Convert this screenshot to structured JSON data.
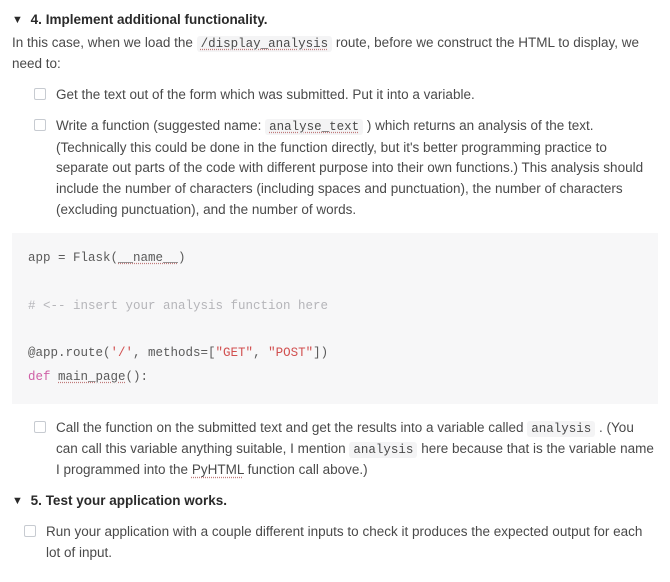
{
  "section4": {
    "num": "4.",
    "title": "Implement additional functionality.",
    "intro_a": "In this case, when we load the ",
    "route_code": "/display_analysis",
    "intro_b": " route, before we construct the HTML to display, we need to:",
    "item1": "Get the text out of the form which was submitted. Put it into a variable.",
    "item2_a": "Write a function (suggested name: ",
    "item2_code": "analyse_text",
    "item2_b": " ) which returns an analysis of the text. (Technically this could be done in the function directly, but it's better programming practice to separate out parts of the code with different purpose into their own functions.) This analysis should include the number of characters (including spaces and punctuation), the number of characters (excluding punctuation), and the number of words.",
    "item3_a": "Call the function on the submitted text and get the results into a variable called ",
    "item3_code1": "analysis",
    "item3_b": " . (You can call this variable anything suitable, I mention ",
    "item3_code2": "analysis",
    "item3_c": " here because that is the variable name I programmed into the ",
    "item3_pyhtml": "PyHTML",
    "item3_d": " function call above.)"
  },
  "code": {
    "l1a": "app = Flask(",
    "l1b": "__name__",
    "l1c": ")",
    "l2": "# <-- insert your analysis function here",
    "l3a": "@app.route(",
    "l3b": "'/'",
    "l3c": ", methods=[",
    "l3d": "\"GET\"",
    "l3e": ", ",
    "l3f": "\"POST\"",
    "l3g": "])",
    "l4a": "def",
    "l4b": " ",
    "l4c": "main_page",
    "l4d": "():"
  },
  "section5": {
    "num": "5.",
    "title": "Test your application works.",
    "item1": "Run your application with a couple different inputs to check it produces the expected output for each lot of input."
  }
}
